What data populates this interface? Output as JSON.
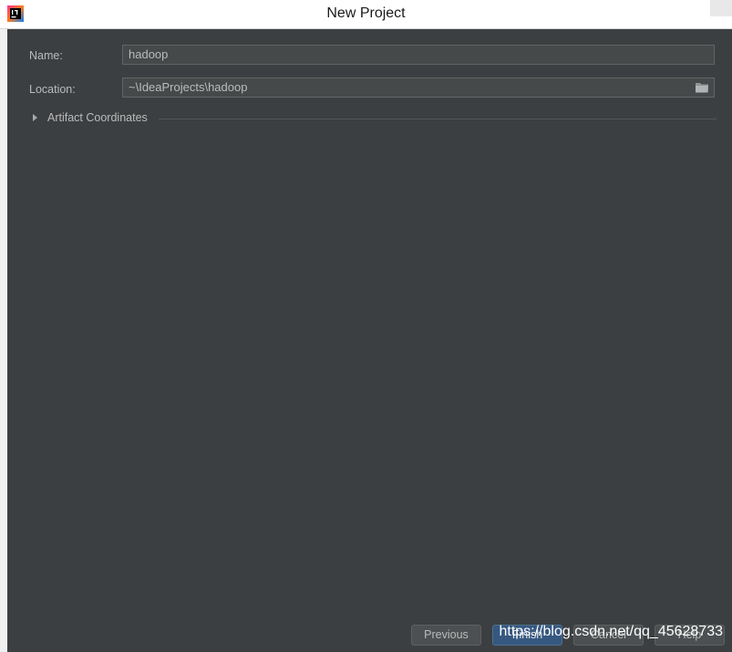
{
  "window": {
    "title": "New Project"
  },
  "form": {
    "name_label": "Name:",
    "name_value": "hadoop",
    "location_label": "Location:",
    "location_value": "~\\IdeaProjects\\hadoop"
  },
  "section": {
    "artifact_label": "Artifact Coordinates"
  },
  "buttons": {
    "previous": "Previous",
    "finish": "Finish",
    "cancel": "Cancel",
    "help": "Help"
  },
  "watermark": "https://blog.csdn.net/qq_45628733",
  "icons": {
    "app": "intellij-idea-icon",
    "browse": "folder-icon",
    "expand": "triangle-right-icon"
  },
  "colors": {
    "background": "#3c3f41",
    "field": "#45494a",
    "primary_button": "#365880"
  }
}
